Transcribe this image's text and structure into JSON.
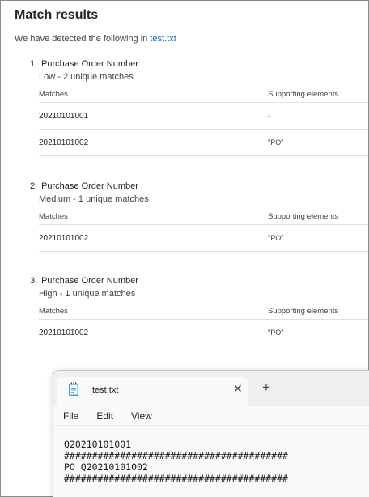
{
  "title": "Match results",
  "detected_prefix": "We have detected the following in ",
  "detected_file": "test.txt",
  "columns": {
    "matches": "Matches",
    "supporting": "Supporting elements"
  },
  "results": [
    {
      "number": "1.",
      "name": "Purchase Order Number",
      "confidence": "Low - 2 unique matches",
      "rows": [
        {
          "match": "20210101001",
          "supporting": "-"
        },
        {
          "match": "20210101002",
          "supporting": "\"PO\""
        }
      ]
    },
    {
      "number": "2.",
      "name": "Purchase Order Number",
      "confidence": "Medium - 1 unique matches",
      "rows": [
        {
          "match": "20210101002",
          "supporting": "\"PO\""
        }
      ]
    },
    {
      "number": "3.",
      "name": "Purchase Order Number",
      "confidence": "High - 1 unique matches",
      "rows": [
        {
          "match": "20210101002",
          "supporting": "\"PO\""
        }
      ]
    }
  ],
  "notepad": {
    "tab_title": "test.txt",
    "close_glyph": "✕",
    "plus_glyph": "+",
    "menu": [
      "File",
      "Edit",
      "View"
    ],
    "lines": [
      "Q20210101001",
      "########################################",
      "PO Q20210101002",
      "########################################"
    ],
    "icon": "notepad-file-icon",
    "accent": "#0f6cbd"
  }
}
